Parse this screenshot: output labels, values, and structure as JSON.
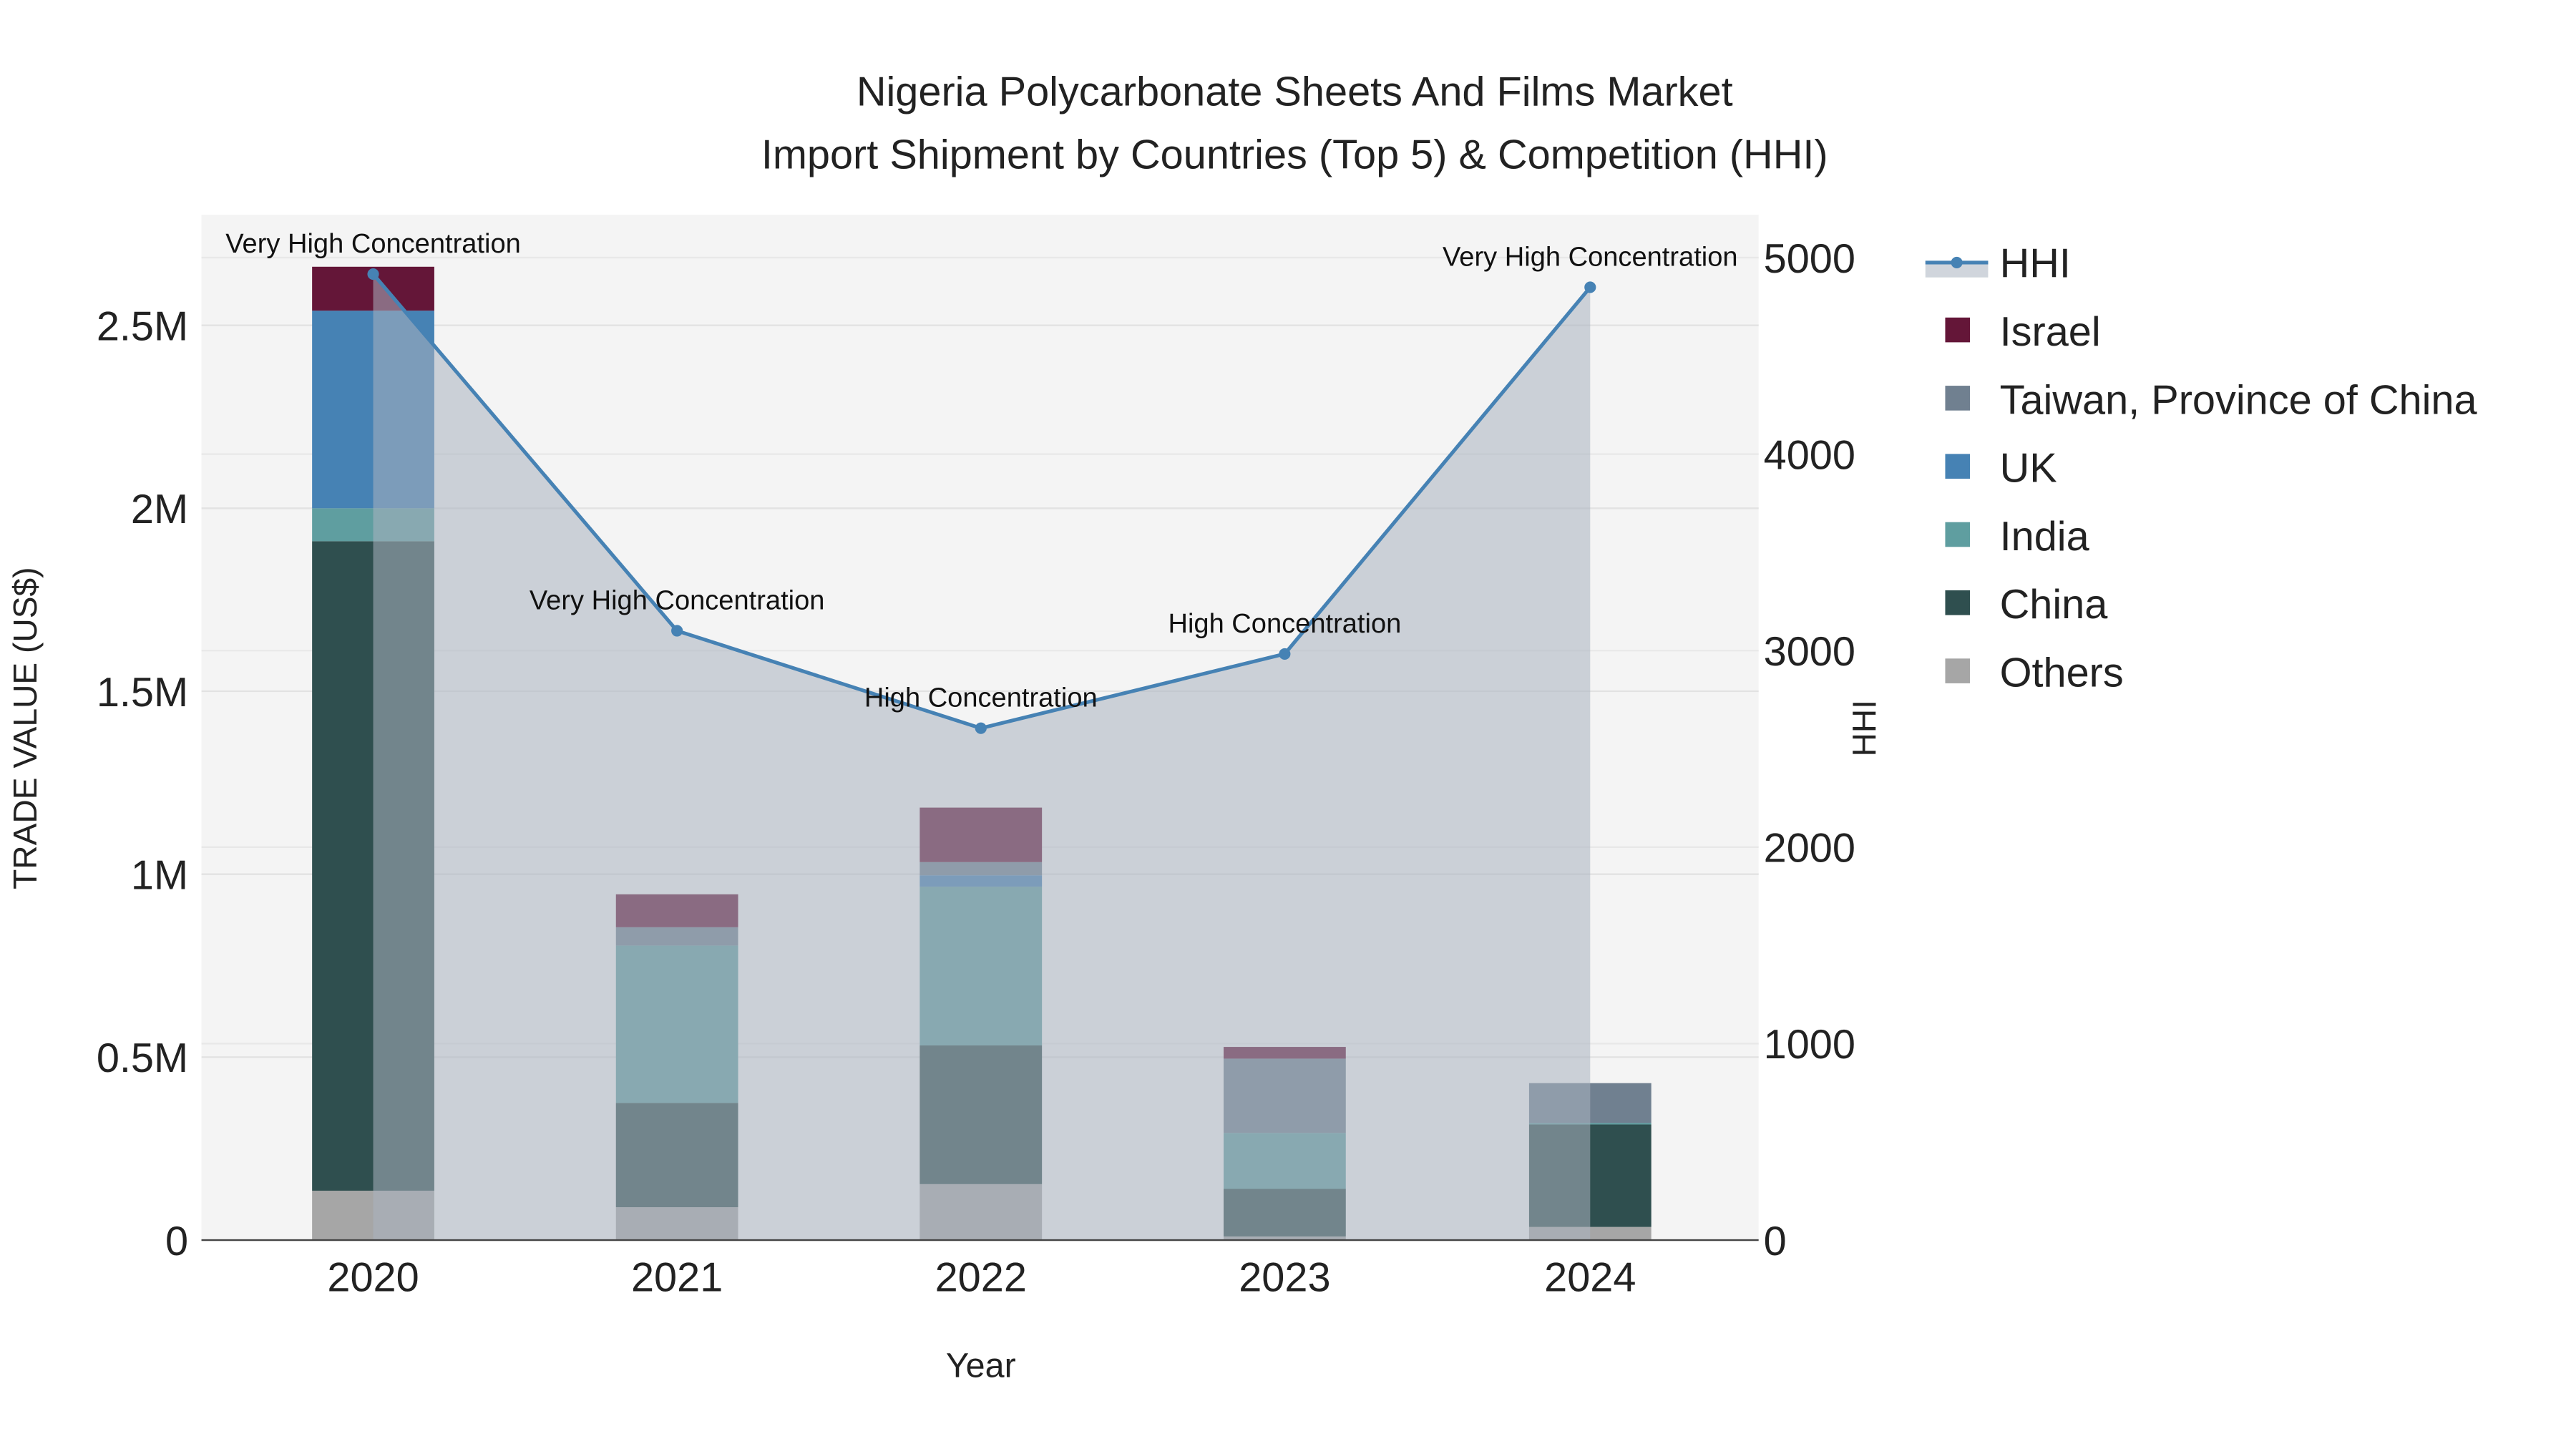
{
  "chart_data": {
    "type": "bar",
    "title": "Nigeria Polycarbonate Sheets And Films Market",
    "subtitle": "Import Shipment by Countries (Top 5) & Competition (HHI)",
    "xlabel": "Year",
    "ylabel": "TRADE VALUE (US$)",
    "y2label": "HHI",
    "categories": [
      "2020",
      "2021",
      "2022",
      "2023",
      "2024"
    ],
    "ylim": [
      0,
      2800000
    ],
    "y2lim": [
      0,
      5200
    ],
    "yticks": [
      {
        "v": 0,
        "label": "0"
      },
      {
        "v": 500000,
        "label": "0.5M"
      },
      {
        "v": 1000000,
        "label": "1M"
      },
      {
        "v": 1500000,
        "label": "1.5M"
      },
      {
        "v": 2000000,
        "label": "2M"
      },
      {
        "v": 2500000,
        "label": "2.5M"
      }
    ],
    "y2ticks": [
      {
        "v": 0,
        "label": "0"
      },
      {
        "v": 1000,
        "label": "1000"
      },
      {
        "v": 2000,
        "label": "2000"
      },
      {
        "v": 3000,
        "label": "3000"
      },
      {
        "v": 4000,
        "label": "4000"
      },
      {
        "v": 5000,
        "label": "5000"
      }
    ],
    "series": [
      {
        "name": "Others",
        "color": "#a6a6a6",
        "values": [
          135000,
          90000,
          153000,
          10000,
          36000
        ]
      },
      {
        "name": "China",
        "color": "#2f4f4f",
        "values": [
          1775000,
          285000,
          379000,
          130000,
          280000
        ]
      },
      {
        "name": "India",
        "color": "#5f9ea0",
        "values": [
          90000,
          430000,
          434000,
          153000,
          4000
        ]
      },
      {
        "name": "UK",
        "color": "#4682b4",
        "values": [
          540000,
          0,
          31000,
          0,
          0
        ]
      },
      {
        "name": "Taiwan, Province of China",
        "color": "#708090",
        "values": [
          0,
          50000,
          36000,
          203000,
          109000
        ]
      },
      {
        "name": "Israel",
        "color": "#641638",
        "values": [
          120000,
          90000,
          149000,
          32000,
          0
        ]
      }
    ],
    "hhi": {
      "name": "HHI",
      "color": "#4682b4",
      "values": [
        4916,
        3101,
        2605,
        2983,
        4849
      ],
      "labels": [
        "Very High Concentration",
        "Very High Concentration",
        "High Concentration",
        "High Concentration",
        "Very High Concentration"
      ]
    },
    "legend_position": "right",
    "legend_order": [
      "HHI",
      "Israel",
      "Taiwan, Province of China",
      "UK",
      "India",
      "China",
      "Others"
    ],
    "grid": true
  }
}
